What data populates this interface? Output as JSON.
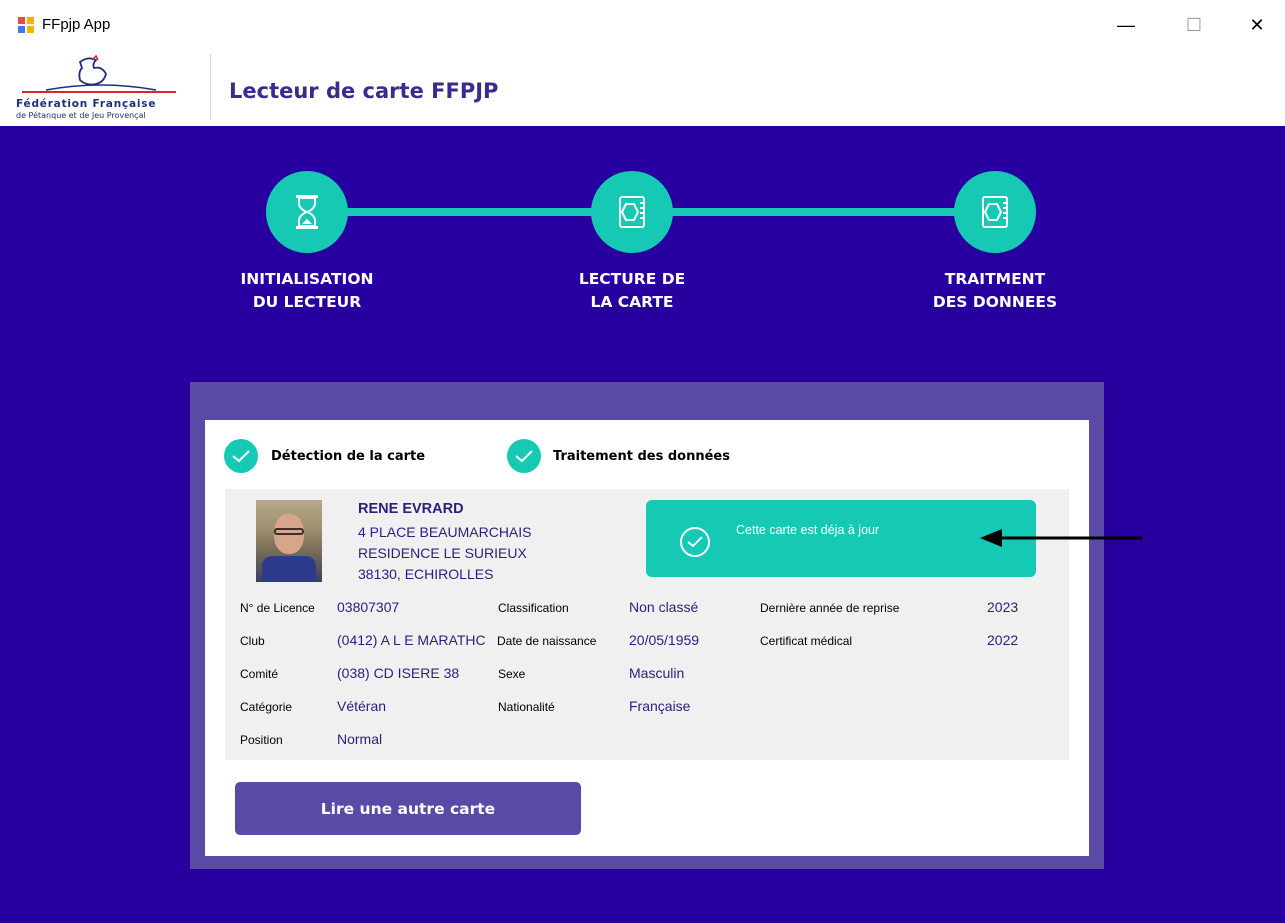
{
  "window": {
    "title": "FFpjp App",
    "minimize": "—",
    "maximize": "☐",
    "close": "✕"
  },
  "header": {
    "logo_line1": "Fédération Française",
    "logo_line2": "de Pétanque et de Jeu Provençal",
    "title": "Lecteur de carte FFPJP"
  },
  "steps": [
    {
      "line1": "INITIALISATION",
      "line2": "DU LECTEUR",
      "icon": "hourglass-icon"
    },
    {
      "line1": "LECTURE DE",
      "line2": "LA CARTE",
      "icon": "card-reader-icon"
    },
    {
      "line1": "TRAITMENT",
      "line2": "DES DONNEES",
      "icon": "card-reader-icon"
    }
  ],
  "checks": {
    "detection": "Détection de la carte",
    "traitement": "Traitement des données"
  },
  "holder": {
    "name": "RENE EVRARD",
    "address1": "4 PLACE BEAUMARCHAIS",
    "address2": "RESIDENCE LE SURIEUX",
    "address3": "38130, ECHIROLLES"
  },
  "status": {
    "message": "Cette carte est déja à jour"
  },
  "fields": {
    "licence_label": "N° de Licence",
    "licence_value": "03807307",
    "club_label": "Club",
    "club_value": "(0412) A L E  MARATHC",
    "comite_label": "Comité",
    "comite_value": "(038) CD ISERE 38",
    "categorie_label": "Catégorie",
    "categorie_value": "Vétéran",
    "position_label": "Position",
    "position_value": "Normal",
    "classification_label": "Classification",
    "classification_value": "Non classé",
    "naissance_label": "Date de naissance",
    "naissance_value": "20/05/1959",
    "sexe_label": "Sexe",
    "sexe_value": "Masculin",
    "nationalite_label": "Nationalité",
    "nationalite_value": "Française",
    "reprise_label": "Dernière année de reprise",
    "reprise_value": "2023",
    "certificat_label": "Certificat médical",
    "certificat_value": "2022"
  },
  "button": {
    "read_another": "Lire une autre carte"
  },
  "colors": {
    "main_bg": "#2800a0",
    "accent_teal": "#16c9b5",
    "panel_purple": "#5a4aa6",
    "text_navy": "#2a1f7a"
  }
}
